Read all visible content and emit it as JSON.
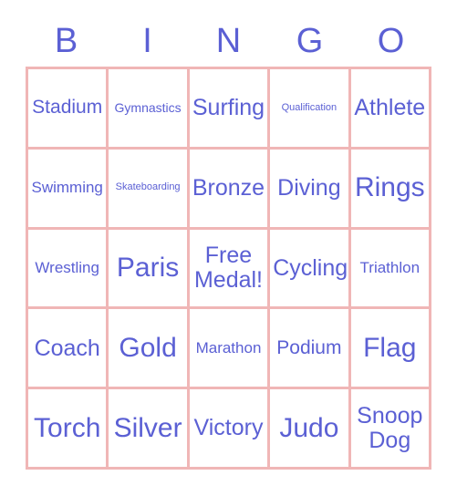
{
  "card": {
    "title": "BINGO",
    "accent_color": "#5b60d4",
    "border_color": "#f0b6b6",
    "background_color": "#ffffff"
  },
  "header": {
    "letters": [
      "B",
      "I",
      "N",
      "G",
      "O"
    ]
  },
  "grid": {
    "columns": 5,
    "rows": 5,
    "cells": [
      {
        "label": "Stadium",
        "size": "lg",
        "free": false
      },
      {
        "label": "Gymnastics",
        "size": "sm",
        "free": false
      },
      {
        "label": "Surfing",
        "size": "xl",
        "free": false
      },
      {
        "label": "Qualification",
        "size": "xs",
        "free": false
      },
      {
        "label": "Athlete",
        "size": "xl",
        "free": false
      },
      {
        "label": "Swimming",
        "size": "md",
        "free": false
      },
      {
        "label": "Skateboarding",
        "size": "xs",
        "free": false
      },
      {
        "label": "Bronze",
        "size": "xl",
        "free": false
      },
      {
        "label": "Diving",
        "size": "xl",
        "free": false
      },
      {
        "label": "Rings",
        "size": "xxl",
        "free": false
      },
      {
        "label": "Wrestling",
        "size": "md",
        "free": false
      },
      {
        "label": "Paris",
        "size": "xxl",
        "free": false
      },
      {
        "label": "Free Medal!",
        "size": "xl",
        "free": true
      },
      {
        "label": "Cycling",
        "size": "xl",
        "free": false
      },
      {
        "label": "Triathlon",
        "size": "md",
        "free": false
      },
      {
        "label": "Coach",
        "size": "xl",
        "free": false
      },
      {
        "label": "Gold",
        "size": "xxl",
        "free": false
      },
      {
        "label": "Marathon",
        "size": "md",
        "free": false
      },
      {
        "label": "Podium",
        "size": "lg",
        "free": false
      },
      {
        "label": "Flag",
        "size": "xxl",
        "free": false
      },
      {
        "label": "Torch",
        "size": "xxl",
        "free": false
      },
      {
        "label": "Silver",
        "size": "xxl",
        "free": false
      },
      {
        "label": "Victory",
        "size": "xl",
        "free": false
      },
      {
        "label": "Judo",
        "size": "xxl",
        "free": false
      },
      {
        "label": "Snoop Dog",
        "size": "xl",
        "free": false
      }
    ]
  }
}
